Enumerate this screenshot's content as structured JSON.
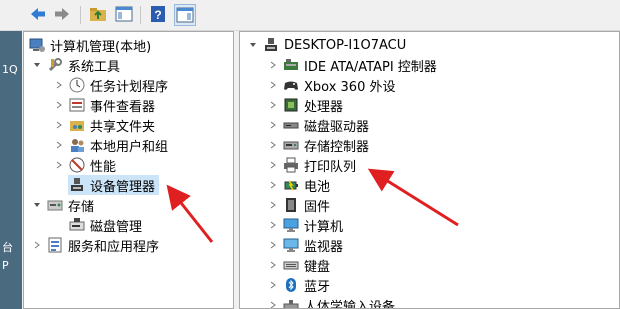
{
  "colors": {
    "selection": "#cce4f7",
    "arrow": "#e02020",
    "accent": "#1f6fbf"
  },
  "toolbar": {
    "buttons": [
      {
        "name": "back-button",
        "icon": "arrow-left-icon"
      },
      {
        "name": "forward-button",
        "icon": "arrow-right-icon"
      },
      {
        "name": "up-folder-button",
        "icon": "folder-up-icon"
      },
      {
        "name": "show-hide-console-tree-button",
        "icon": "console-tree-icon"
      },
      {
        "name": "help-button",
        "icon": "help-icon"
      },
      {
        "name": "action-pane-button",
        "icon": "action-pane-icon"
      }
    ]
  },
  "background_text": {
    "line1": "1Q",
    "line2": "台",
    "line3": "P"
  },
  "left_tree": {
    "root": "计算机管理(本地)",
    "system_tools": "系统工具",
    "task_scheduler": "任务计划程序",
    "event_viewer": "事件查看器",
    "shared_folders": "共享文件夹",
    "local_users": "本地用户和组",
    "performance": "性能",
    "device_manager": "设备管理器",
    "storage": "存储",
    "disk_management": "磁盘管理",
    "services_apps": "服务和应用程序"
  },
  "right_tree": {
    "computer_name": "DESKTOP-I1O7ACU",
    "categories": [
      "IDE ATA/ATAPI 控制器",
      "Xbox 360 外设",
      "处理器",
      "磁盘驱动器",
      "存储控制器",
      "打印队列",
      "电池",
      "固件",
      "计算机",
      "监视器",
      "键盘",
      "蓝牙",
      "人体学输入设备"
    ]
  }
}
